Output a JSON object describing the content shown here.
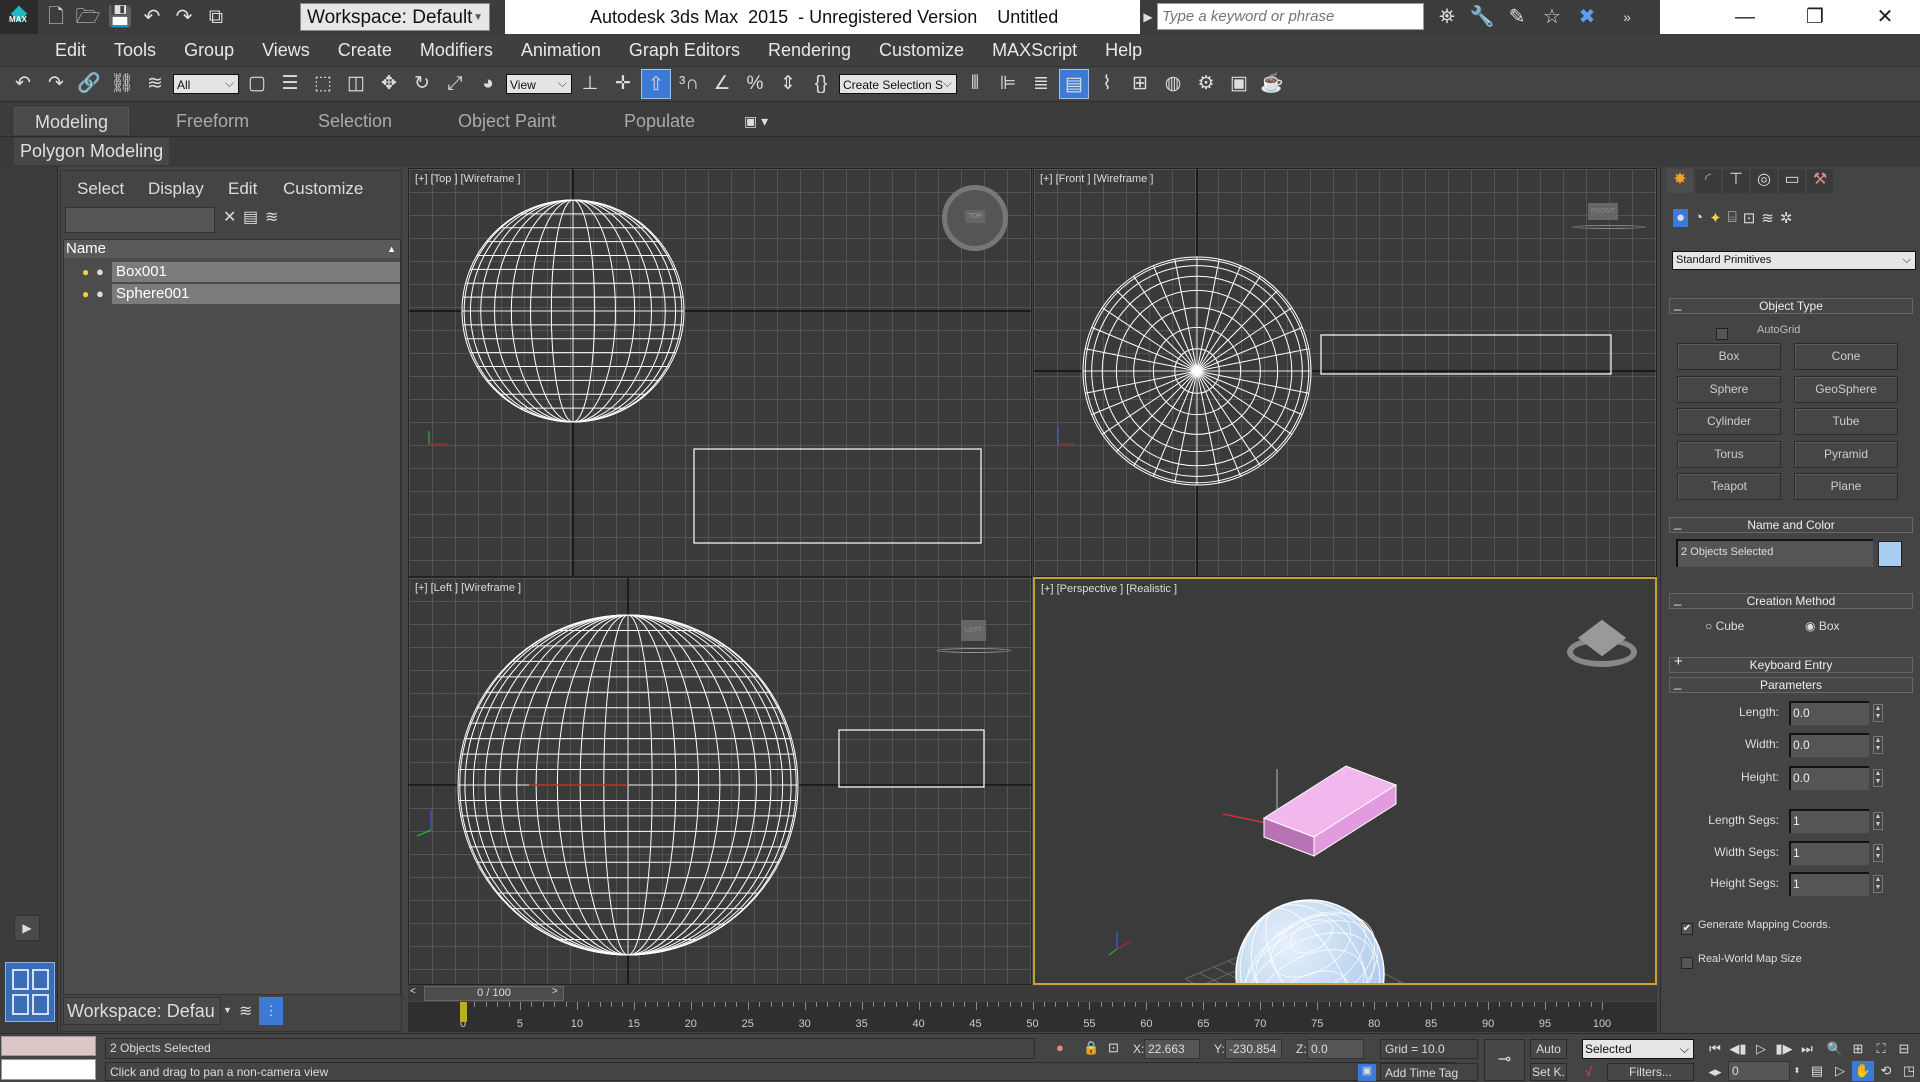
{
  "titlebar": {
    "logo_text": "MAX",
    "workspace": "Workspace: Default",
    "title": "Autodesk 3ds Max  2015  - Unregistered Version    Untitled",
    "search_placeholder": "Type a keyword or phrase",
    "quick_access_icons": [
      "new-file-icon",
      "open-file-icon",
      "save-icon",
      "undo-icon",
      "redo-icon",
      "project-folder-icon"
    ],
    "info_icons": [
      "binoculars-icon",
      "key-tools-icon",
      "subscription-icon",
      "favorites-star-icon",
      "exchange-x-icon",
      "more-arrows-icon"
    ],
    "window_controls": [
      "minimize",
      "restore",
      "close"
    ]
  },
  "menu": [
    "Edit",
    "Tools",
    "Group",
    "Views",
    "Create",
    "Modifiers",
    "Animation",
    "Graph Editors",
    "Rendering",
    "Customize",
    "MAXScript",
    "Help"
  ],
  "toolbar": {
    "selection_filter": "All",
    "ref_coord": "View",
    "named_selection": "Create Selection S",
    "icons": [
      "undo-icon",
      "redo-icon",
      "link-icon",
      "unlink-icon",
      "bind-space-warp-icon",
      "selection-filter",
      "select-object-icon",
      "select-by-name-icon",
      "rect-selection-icon",
      "window-crossing-icon",
      "move-icon",
      "rotate-icon",
      "scale-icon",
      "place-icon",
      "ref-coord",
      "pivot-icon",
      "manipulate-icon",
      "keyboard-shortcut-icon",
      "snap-3d-icon",
      "angle-snap-icon",
      "percent-snap-icon",
      "spinner-snap-icon",
      "edit-named-selections-icon",
      "named-selection",
      "mirror-icon",
      "align-icon",
      "layer-explorer-icon",
      "scene-explorer-toggle-icon",
      "curve-editor-icon",
      "schematic-view-icon",
      "material-editor-icon",
      "render-setup-icon",
      "rendered-frame-icon",
      "render-icon"
    ]
  },
  "ribbon": {
    "tabs": [
      "Modeling",
      "Freeform",
      "Selection",
      "Object Paint",
      "Populate"
    ],
    "active_tab": "Modeling",
    "panel": "Polygon Modeling"
  },
  "explorer": {
    "menu": [
      "Select",
      "Display",
      "Edit",
      "Customize"
    ],
    "column": "Name",
    "rows": [
      {
        "name": "Box001"
      },
      {
        "name": "Sphere001"
      }
    ],
    "workspace": "Workspace: Defau"
  },
  "viewports": [
    {
      "label": "[+] [Top ] [Wireframe ]",
      "cube": "TOP"
    },
    {
      "label": "[+] [Front ] [Wireframe ]",
      "cube": "FRONT"
    },
    {
      "label": "[+] [Left ] [Wireframe ]",
      "cube": "LEFT"
    },
    {
      "label": "[+] [Perspective ] [Realistic ]"
    }
  ],
  "command_panel": {
    "tabs": [
      "create-tab",
      "modify-tab",
      "hierarchy-tab",
      "motion-tab",
      "display-tab",
      "utilities-tab"
    ],
    "categories": [
      "geometry",
      "shapes",
      "lights",
      "cameras",
      "helpers",
      "space-warps",
      "systems"
    ],
    "subcategory": "Standard Primitives",
    "object_type": {
      "title": "Object Type",
      "autogrid": "AutoGrid",
      "autogrid_checked": false,
      "buttons": [
        "Box",
        "Cone",
        "Sphere",
        "GeoSphere",
        "Cylinder",
        "Tube",
        "Torus",
        "Pyramid",
        "Teapot",
        "Plane"
      ]
    },
    "name_color": {
      "title": "Name and Color",
      "name": "2 Objects Selected",
      "color": "#a8cff2"
    },
    "creation_method": {
      "title": "Creation Method",
      "options": [
        "Cube",
        "Box"
      ],
      "selected": "Box"
    },
    "keyboard_entry": {
      "title": "Keyboard Entry"
    },
    "parameters": {
      "title": "Parameters",
      "fields": [
        {
          "label": "Length:",
          "value": "0.0"
        },
        {
          "label": "Width:",
          "value": "0.0"
        },
        {
          "label": "Height:",
          "value": "0.0"
        },
        {
          "label": "Length Segs:",
          "value": "1"
        },
        {
          "label": "Width Segs:",
          "value": "1"
        },
        {
          "label": "Height Segs:",
          "value": "1"
        }
      ],
      "gen_mapping": "Generate Mapping Coords.",
      "gen_mapping_checked": true,
      "real_world": "Real-World Map Size",
      "real_world_checked": false
    }
  },
  "timeline": {
    "frame": "0 / 100",
    "ticks": [
      0,
      5,
      10,
      15,
      20,
      25,
      30,
      35,
      40,
      45,
      50,
      55,
      60,
      65,
      70,
      75,
      80,
      85,
      90,
      95,
      100
    ],
    "range": [
      0,
      100
    ]
  },
  "status": {
    "selection": "2 Objects Selected",
    "prompt": "Click and drag to pan a non-camera view",
    "x_label": "X:",
    "x": "22.663",
    "y_label": "Y:",
    "y": "-230.854",
    "z_label": "Z:",
    "z": "0.0",
    "grid": "Grid = 10.0",
    "add_time_tag": "Add Time Tag",
    "auto": "Auto",
    "setk": "Set K.",
    "key_mode": "Selected",
    "filters": "Filters...",
    "current_frame": "0"
  },
  "colors": {
    "accent": "#3d7ad6",
    "perspective_border": "#c8a12a",
    "box_color": "#e39be0",
    "sphere_color": "#a9c8ea"
  }
}
